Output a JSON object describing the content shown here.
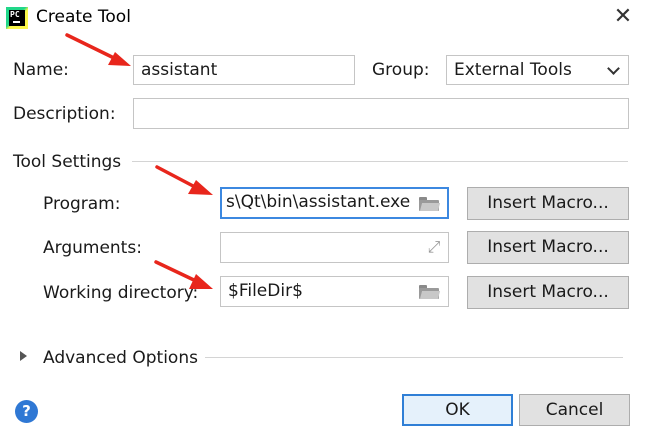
{
  "window": {
    "title": "Create Tool",
    "app_icon_text": "PC"
  },
  "form": {
    "name_label": "Name:",
    "name_value": "assistant",
    "group_label": "Group:",
    "group_value": "External Tools",
    "description_label": "Description:",
    "description_value": ""
  },
  "tool_settings": {
    "section_label": "Tool Settings",
    "program_label": "Program:",
    "program_value": "s\\Qt\\bin\\assistant.exe",
    "arguments_label": "Arguments:",
    "arguments_value": "",
    "working_dir_label": "Working directory:",
    "working_dir_value": "$FileDir$",
    "insert_macro_label": "Insert Macro..."
  },
  "advanced": {
    "label": "Advanced Options"
  },
  "footer": {
    "ok_label": "OK",
    "cancel_label": "Cancel",
    "help_label": "?"
  },
  "colors": {
    "accent_border": "#3c88e0",
    "annotation_arrow": "#e8261c",
    "help_icon": "#2f78d4"
  }
}
